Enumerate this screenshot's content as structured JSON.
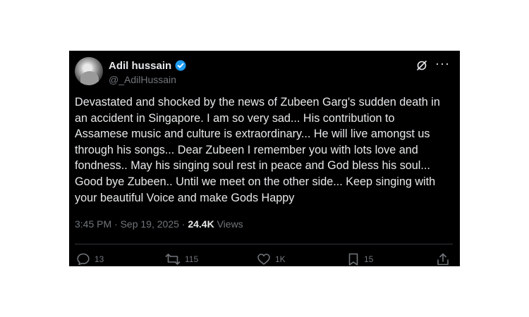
{
  "author": {
    "name": "Adil hussain",
    "handle": "@_AdilHussain"
  },
  "tweet": {
    "text": "Devastated and shocked by the news of Zubeen Garg's sudden death in\nan accident in Singapore. I am so very sad... His contribution to\nAssamese music and culture is extraordinary... He will live amongst us\nthrough his songs... Dear Zubeen I remember you with lots love and\nfondness.. May his singing soul rest in peace and God bless his soul...\nGood bye Zubeen.. Until we meet on the other side... Keep singing with\nyour beautiful Voice and make Gods Happy",
    "time": "3:45 PM",
    "separator": "·",
    "date": "Sep 19, 2025",
    "views_count": "24.4K",
    "views_label": "Views"
  },
  "actions": {
    "replies": "13",
    "reposts": "115",
    "likes": "1K",
    "bookmarks": "15"
  },
  "icons": {
    "verified": "verified-badge-icon",
    "grok": "grok-icon",
    "more": "more-icon",
    "reply": "reply-icon",
    "repost": "repost-icon",
    "like": "heart-icon",
    "bookmark": "bookmark-icon",
    "share": "share-icon"
  },
  "colors": {
    "background": "#000000",
    "text": "#e7e9ea",
    "muted": "#71767b",
    "verified": "#1d9bf0"
  }
}
